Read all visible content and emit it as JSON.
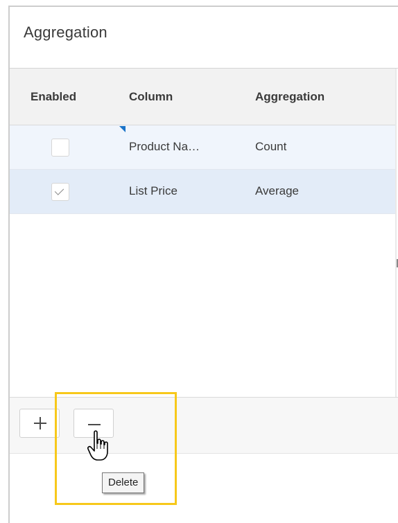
{
  "panel": {
    "title": "Aggregation"
  },
  "grid": {
    "columns": {
      "enabled": "Enabled",
      "column": "Column",
      "aggregation": "Aggregation"
    },
    "rows": [
      {
        "enabled": false,
        "column": "Product Na…",
        "aggregation": "Count"
      },
      {
        "enabled": true,
        "column": "List Price",
        "aggregation": "Average"
      }
    ]
  },
  "toolbar": {
    "add_icon": "plus-icon",
    "delete_icon": "minus-icon"
  },
  "tooltip": {
    "text": "Delete"
  },
  "colors": {
    "highlight": "#f7c81a",
    "row_selected": "#e3ecf8",
    "dirty_marker": "#1a73c8"
  }
}
